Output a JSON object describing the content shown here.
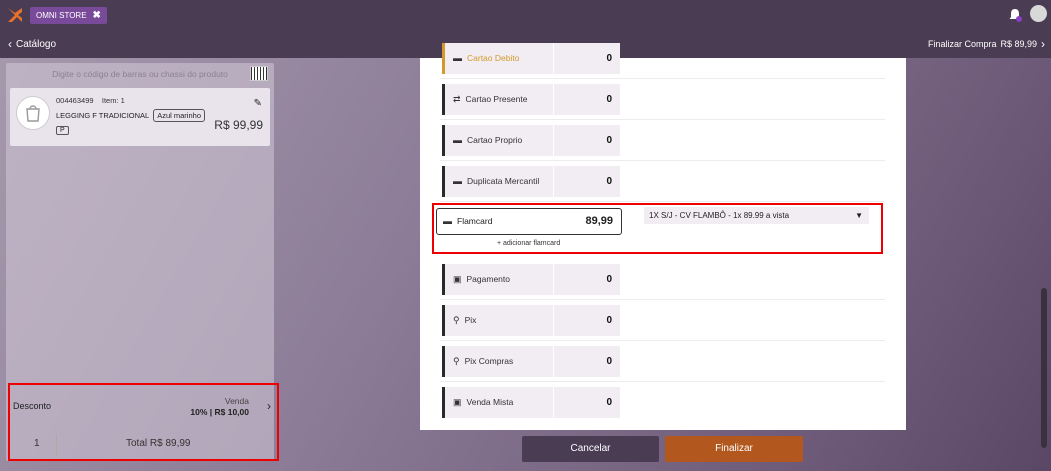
{
  "header": {
    "store_tab": "OMNI STORE",
    "close_glyph": "✖"
  },
  "subheader": {
    "back_label": "Catálogo",
    "finalize_label": "Finalizar Compra",
    "finalize_amount": "R$ 89,99"
  },
  "search": {
    "placeholder": "Digite o código de barras ou chassi do produto"
  },
  "product": {
    "code": "004463499",
    "item": "Item: 1",
    "name": "LEGGING F TRADICIONAL",
    "color": "Azul marinho",
    "size": "P",
    "price": "R$ 99,99"
  },
  "discount": {
    "label": "Desconto",
    "type": "Venda",
    "value": "10% | R$ 10,00"
  },
  "summary": {
    "quantity": "1",
    "total": "Total R$ 89,99"
  },
  "payments": [
    {
      "label": "Cartao Debito",
      "value": "0",
      "icon": "card-icon"
    },
    {
      "label": "Cartao Presente",
      "value": "0",
      "icon": "transfer-icon"
    },
    {
      "label": "Cartao Proprio",
      "value": "0",
      "icon": "card-icon"
    },
    {
      "label": "Duplicata Mercantil",
      "value": "0",
      "icon": "card-icon"
    },
    {
      "label": "Flamcard",
      "value": "89,99",
      "icon": "card-icon"
    },
    {
      "label": "Pagamento",
      "value": "0",
      "icon": "cash-icon"
    },
    {
      "label": "Pix",
      "value": "0",
      "icon": "link-icon"
    },
    {
      "label": "Pix Compras",
      "value": "0",
      "icon": "link-icon"
    },
    {
      "label": "Venda Mista",
      "value": "0",
      "icon": "cash-icon"
    }
  ],
  "flamcard": {
    "add_label": "+ adicionar flamcard",
    "installment_selected": "1X S/J - CV FLAMBÔ - 1x 89.99 a vista"
  },
  "actions": {
    "cancel": "Cancelar",
    "finalize": "Finalizar"
  },
  "colors": {
    "topbar": "#4a3c52",
    "accent": "#b2581e",
    "highlight": "#e00000"
  }
}
